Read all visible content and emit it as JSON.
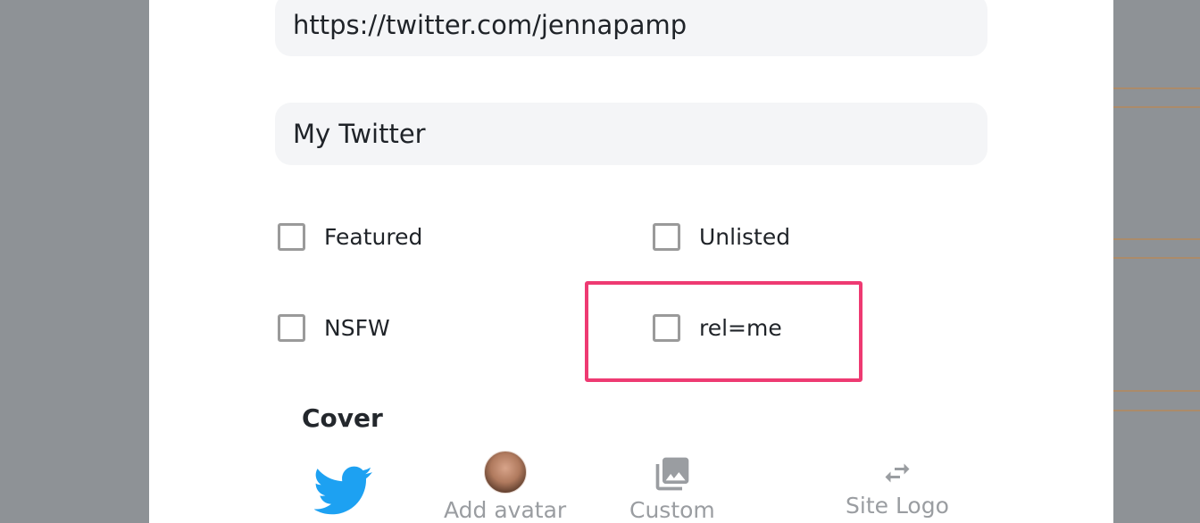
{
  "link_form": {
    "url_value": "https://twitter.com/jennapamp",
    "title_value": "My Twitter"
  },
  "options": {
    "featured_label": "Featured",
    "unlisted_label": "Unlisted",
    "nsfw_label": "NSFW",
    "relme_label": "rel=me"
  },
  "cover": {
    "heading": "Cover",
    "add_avatar_label": "Add avatar",
    "custom_label": "Custom",
    "site_logo_label": "Site Logo"
  },
  "colors": {
    "highlight": "#ee3a72",
    "twitter_blue": "#1da1f2",
    "backdrop": "#8e9296"
  }
}
